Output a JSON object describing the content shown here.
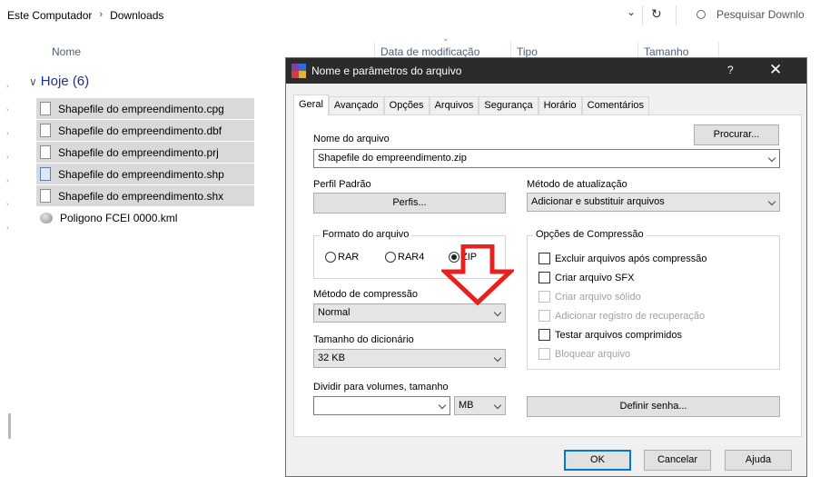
{
  "explorer": {
    "breadcrumb": [
      "Este Computador",
      "Downloads"
    ],
    "breadcrumb_sep": "›",
    "search_placeholder": "Pesquisar Downlo",
    "columns": {
      "name": "Nome",
      "date": "Data de modificação",
      "type": "Tipo",
      "size": "Tamanho"
    },
    "group_label": "Hoje (6)",
    "files": [
      {
        "name": "Shapefile do empreendimento.cpg",
        "icon": "generic-file-icon",
        "selected": true
      },
      {
        "name": "Shapefile do empreendimento.dbf",
        "icon": "generic-file-icon",
        "selected": true
      },
      {
        "name": "Shapefile do empreendimento.prj",
        "icon": "generic-file-icon",
        "selected": true
      },
      {
        "name": "Shapefile do empreendimento.shp",
        "icon": "shp-file-icon",
        "selected": true
      },
      {
        "name": "Shapefile do empreendimento.shx",
        "icon": "generic-file-icon",
        "selected": true
      },
      {
        "name": "Poligono FCEI 0000.kml",
        "icon": "kml-globe-icon",
        "selected": false
      }
    ]
  },
  "dialog": {
    "title": "Nome e parâmetros do arquivo",
    "help": "?",
    "close": "✕",
    "tabs": [
      "Geral",
      "Avançado",
      "Opções",
      "Arquivos",
      "Segurança",
      "Horário",
      "Comentários"
    ],
    "active_tab": "Geral",
    "archive_name_label": "Nome do arquivo",
    "browse_button": "Procurar...",
    "archive_name_value": "Shapefile do empreendimento.zip",
    "profile_label": "Perfil Padrão",
    "profiles_button": "Perfis...",
    "update_method_label": "Método de atualização",
    "update_method_value": "Adicionar e substituir arquivos",
    "format_group": "Formato do arquivo",
    "format_options": [
      "RAR",
      "RAR4",
      "ZIP"
    ],
    "format_selected": "ZIP",
    "compression_options_group": "Opções de Compressão",
    "compression_options": [
      {
        "label": "Excluir arquivos após compressão",
        "enabled": true
      },
      {
        "label": "Criar arquivo SFX",
        "enabled": true
      },
      {
        "label": "Criar arquivo sólido",
        "enabled": false
      },
      {
        "label": "Adicionar registro de recuperação",
        "enabled": false
      },
      {
        "label": "Testar arquivos comprimidos",
        "enabled": true
      },
      {
        "label": "Bloquear arquivo",
        "enabled": false
      }
    ],
    "compression_method_label": "Método de compressão",
    "compression_method_value": "Normal",
    "dictionary_label": "Tamanho do dicionário",
    "dictionary_value": "32 KB",
    "split_label": "Dividir para volumes, tamanho",
    "split_value": "",
    "split_unit": "MB",
    "password_button": "Definir senha...",
    "ok_button": "OK",
    "cancel_button": "Cancelar",
    "help_button": "Ajuda"
  },
  "colors": {
    "annotation_arrow": "#e8211f",
    "titlebar": "#2b2b2b",
    "selection": "#d9d9d9",
    "group_header": "#1e3287"
  }
}
